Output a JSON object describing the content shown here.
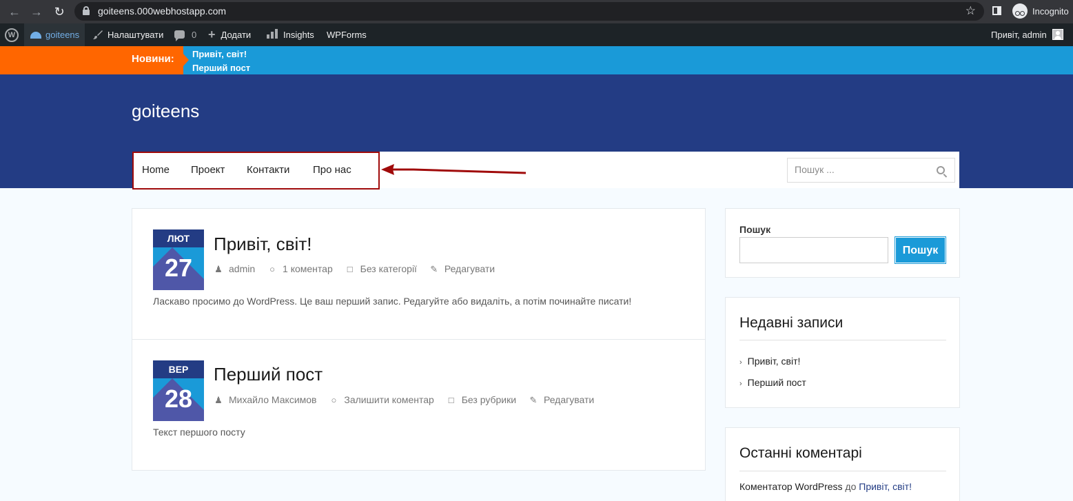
{
  "browser": {
    "url": "goiteens.000webhostapp.com",
    "profile_label": "Incognito"
  },
  "adminbar": {
    "site_name": "goiteens",
    "customize_label": "Налаштувати",
    "comments_count": "0",
    "add_label": "Додати",
    "insights_label": "Insights",
    "wpforms_label": "WPForms",
    "greeting": "Привіт, admin"
  },
  "ticker": {
    "label": "Новини:",
    "items": [
      "Привіт, світ!",
      "Перший пост"
    ]
  },
  "header": {
    "site_title": "goiteens",
    "menu": [
      {
        "label": "Home"
      },
      {
        "label": "Проект"
      },
      {
        "label": "Контакти"
      },
      {
        "label": "Про нас"
      }
    ],
    "search_placeholder": "Пошук ..."
  },
  "posts": [
    {
      "month": "ЛЮТ",
      "day": "27",
      "title": "Привіт, світ!",
      "author": "admin",
      "comments": "1 коментар",
      "category": "Без категорії",
      "edit": "Редагувати",
      "excerpt": "Ласкаво просимо до WordPress. Це ваш перший запис. Редагуйте або видаліть, а потім починайте писати!"
    },
    {
      "month": "ВЕР",
      "day": "28",
      "title": "Перший пост",
      "author": "Михайло Максимов",
      "comments": "Залишити коментар",
      "category": "Без рубрики",
      "edit": "Редагувати",
      "excerpt": "Текст першого посту"
    }
  ],
  "sidebar": {
    "search": {
      "label": "Пошук",
      "button": "Пошук"
    },
    "recent_posts": {
      "title": "Недавні записи",
      "items": [
        "Привіт, світ!",
        "Перший пост"
      ]
    },
    "recent_comments": {
      "title": "Останні коментарі",
      "author": "Коментатор WordPress",
      "connector": "до",
      "post": "Привіт, світ!"
    }
  },
  "colors": {
    "header_blue": "#233c84",
    "accent_blue": "#1a9ad8",
    "ticker_orange": "#ff6600",
    "annotation_red": "#a00a0a"
  }
}
